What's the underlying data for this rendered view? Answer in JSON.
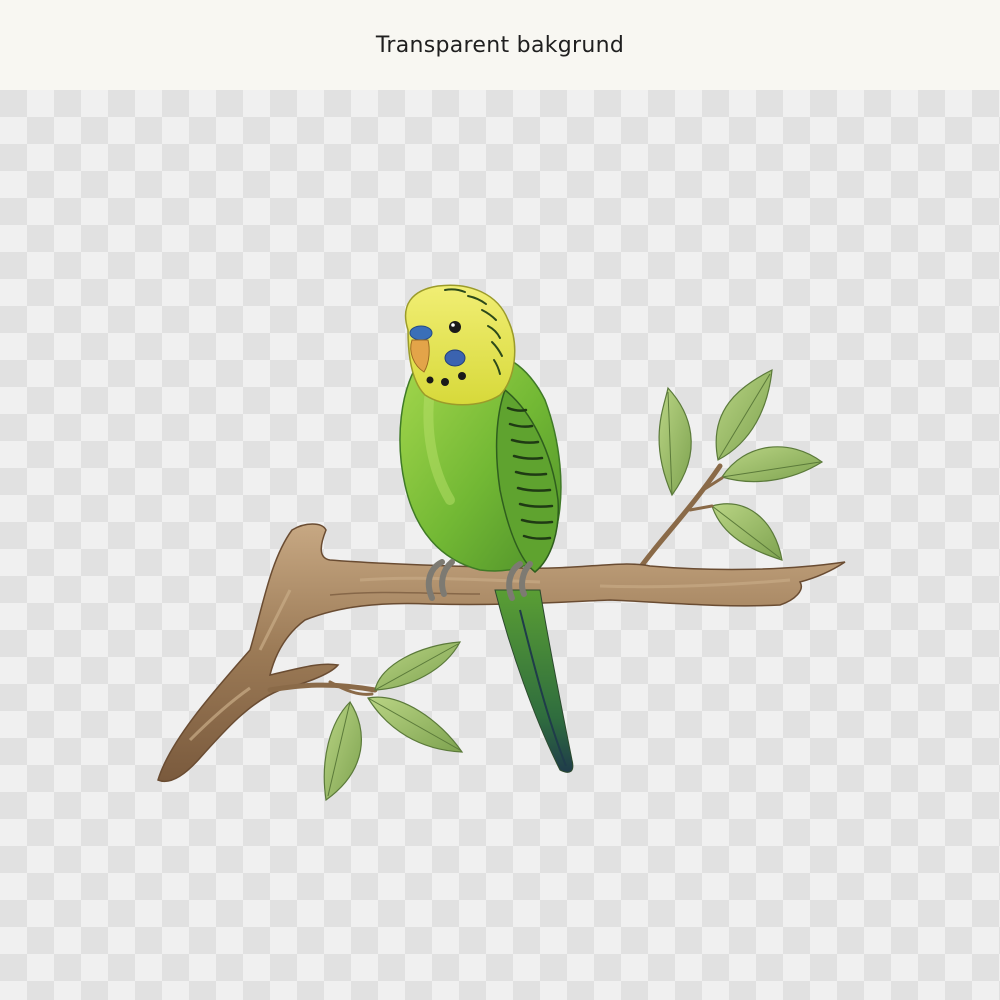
{
  "header": {
    "title": "Transparent bakgrund"
  },
  "canvas": {
    "background_pattern": "transparency-checkerboard",
    "checker_light": "#f0f0f0",
    "checker_dark": "#e1e1e1"
  },
  "illustration": {
    "subject_icon": "budgerigar-on-branch-icon",
    "style": "watercolor",
    "colors": {
      "bird_body": "#7dc23a",
      "bird_head": "#e6e44a",
      "cere": "#3a6fb8",
      "branch": "#9b7a56",
      "leaf": "#9fbd6a"
    }
  }
}
